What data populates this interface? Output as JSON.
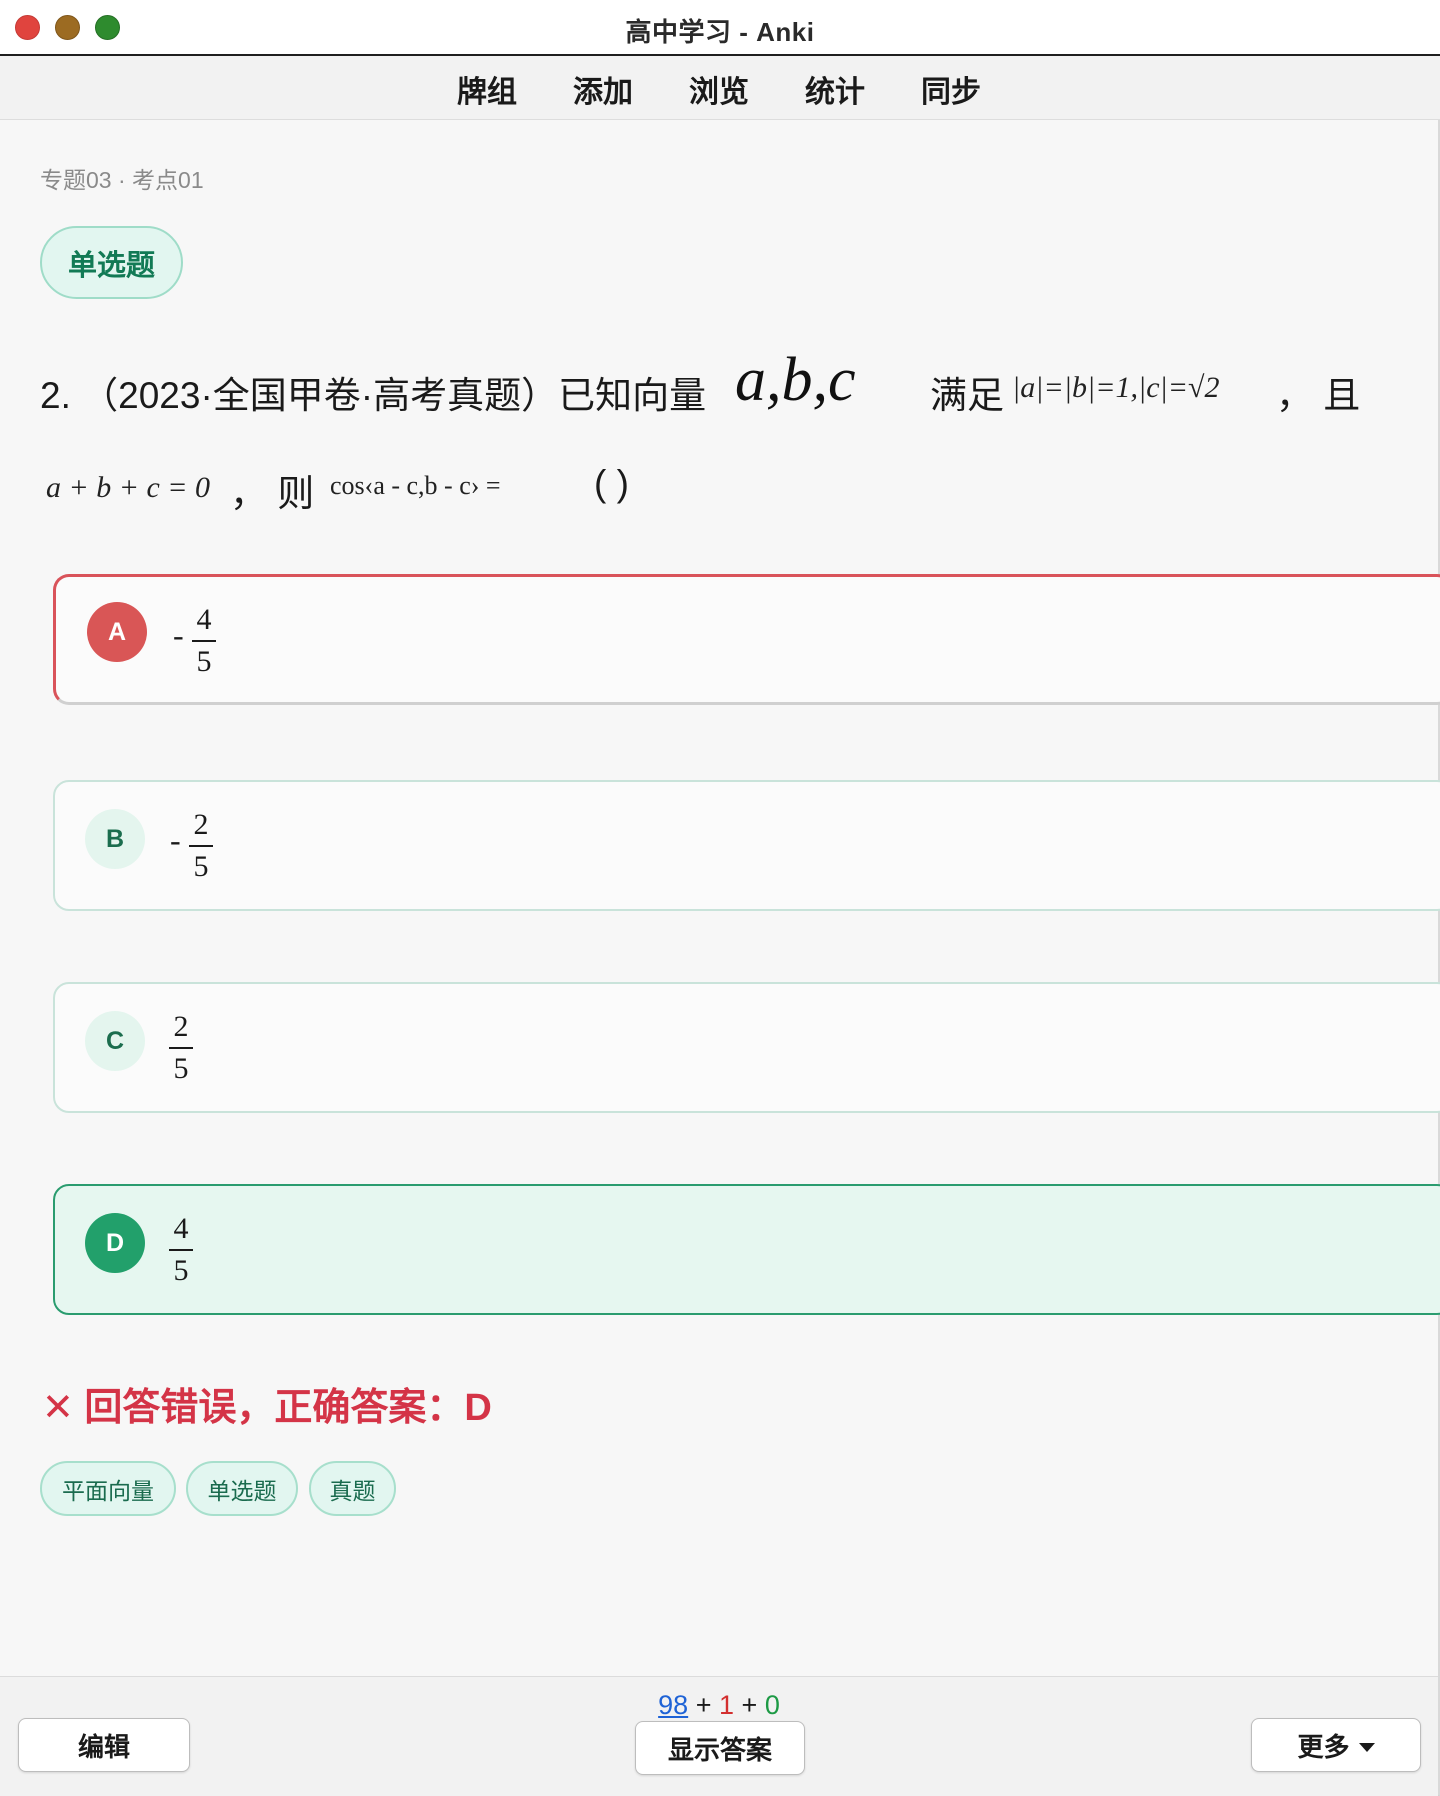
{
  "window": {
    "title": "高中学习 - Anki"
  },
  "toolbar": {
    "items": [
      "牌组",
      "添加",
      "浏览",
      "统计",
      "同步"
    ]
  },
  "card": {
    "breadcrumb": "专题03 · 考点01",
    "question_type": "单选题",
    "question": {
      "prefix": "2. （2023·全国甲卷·高考真题）已知向量",
      "vectors": "a,b,c",
      "cond_word": "满足",
      "condition": "|a|=|b|=1,|c|=√2",
      "comma_and": "， 且",
      "line2_expr": "a + b + c = 0",
      "then_word": "， 则",
      "cos_expr": "cos‹a - c,b - c› =",
      "blank": "( )"
    },
    "options": [
      {
        "letter": "A",
        "sign": "-",
        "numerator": "4",
        "denominator": "5",
        "state": "selected-wrong"
      },
      {
        "letter": "B",
        "sign": "-",
        "numerator": "2",
        "denominator": "5",
        "state": "normal"
      },
      {
        "letter": "C",
        "sign": "",
        "numerator": "2",
        "denominator": "5",
        "state": "normal"
      },
      {
        "letter": "D",
        "sign": "",
        "numerator": "4",
        "denominator": "5",
        "state": "correct"
      }
    ],
    "result": "✕ 回答错误，正确答案：D",
    "tags": [
      "平面向量",
      "单选题",
      "真题"
    ]
  },
  "bottom": {
    "counts": {
      "new": "98",
      "learning": "1",
      "review": "0",
      "sep": "+"
    },
    "edit_label": "编辑",
    "show_answer_label": "显示答案",
    "more_label": "更多"
  },
  "colors": {
    "wrong": "#d9535a",
    "correct": "#22a06b",
    "accent_green": "#127a55",
    "new": "#1f63d6",
    "learning": "#d32f2f",
    "review": "#1d9a45"
  }
}
